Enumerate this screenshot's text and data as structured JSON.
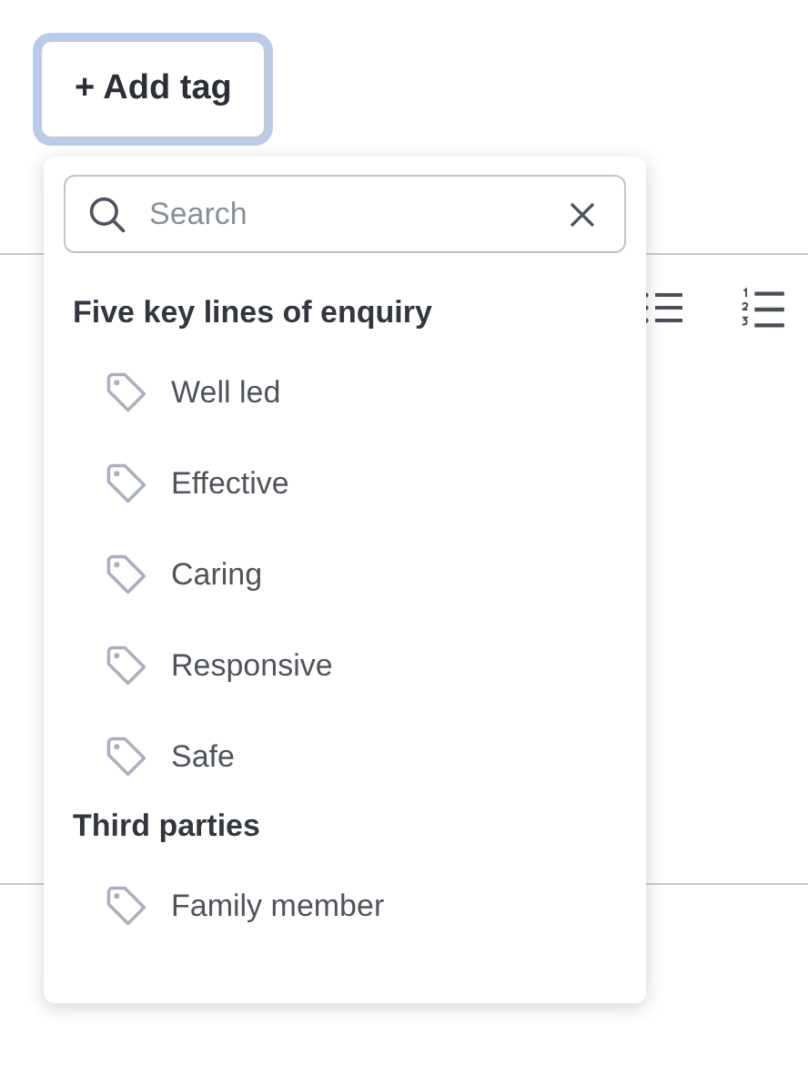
{
  "add_button": {
    "label": "+ Add tag",
    "focused": true
  },
  "search": {
    "placeholder": "Search"
  },
  "groups": [
    {
      "title": "Five key lines of enquiry",
      "items": [
        {
          "label": "Well led"
        },
        {
          "label": "Effective"
        },
        {
          "label": "Caring"
        },
        {
          "label": "Responsive"
        },
        {
          "label": "Safe"
        }
      ]
    },
    {
      "title": "Third parties",
      "items": [
        {
          "label": "Family member"
        }
      ]
    }
  ]
}
